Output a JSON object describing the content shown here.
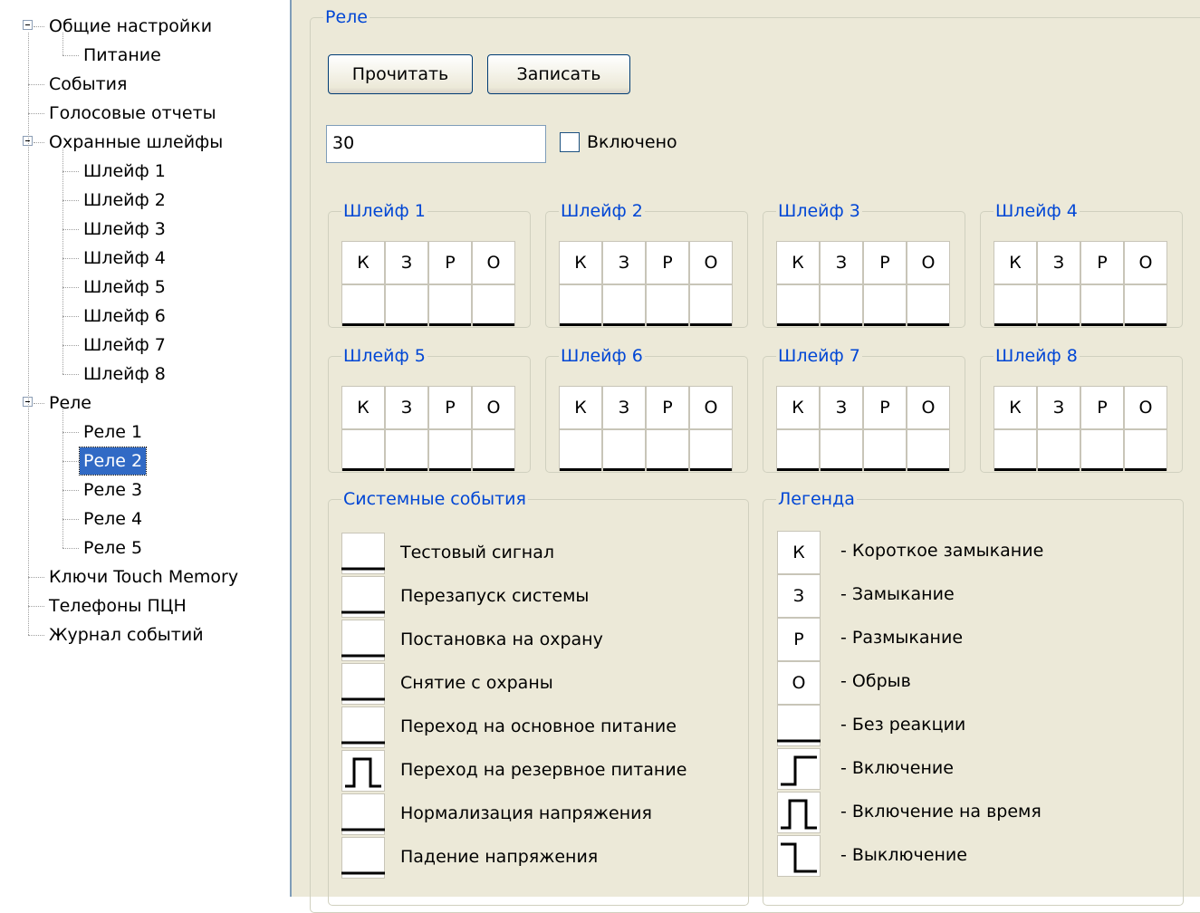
{
  "tree": {
    "items": [
      {
        "label": "Общие настройки",
        "level": 0,
        "expanded": true
      },
      {
        "label": "Питание",
        "level": 1
      },
      {
        "label": "События",
        "level": 0
      },
      {
        "label": "Голосовые отчеты",
        "level": 0
      },
      {
        "label": "Охранные шлейфы",
        "level": 0,
        "expanded": true
      },
      {
        "label": "Шлейф 1",
        "level": 1
      },
      {
        "label": "Шлейф 2",
        "level": 1
      },
      {
        "label": "Шлейф 3",
        "level": 1
      },
      {
        "label": "Шлейф 4",
        "level": 1
      },
      {
        "label": "Шлейф 5",
        "level": 1
      },
      {
        "label": "Шлейф 6",
        "level": 1
      },
      {
        "label": "Шлейф 7",
        "level": 1
      },
      {
        "label": "Шлейф 8",
        "level": 1
      },
      {
        "label": "Реле",
        "level": 0,
        "expanded": true
      },
      {
        "label": "Реле 1",
        "level": 1
      },
      {
        "label": "Реле 2",
        "level": 1,
        "selected": true
      },
      {
        "label": "Реле 3",
        "level": 1
      },
      {
        "label": "Реле 4",
        "level": 1
      },
      {
        "label": "Реле 5",
        "level": 1
      },
      {
        "label": "Ключи Touch Memory",
        "level": 0
      },
      {
        "label": "Телефоны ПЦН",
        "level": 0
      },
      {
        "label": "Журнал событий",
        "level": 0
      }
    ]
  },
  "relay": {
    "group_title": "Реле",
    "read_button": "Прочитать",
    "write_button": "Записать",
    "value": "30",
    "enabled_label": "Включено",
    "enabled_checked": false
  },
  "loops": [
    {
      "title": "Шлейф 1",
      "cols": [
        "К",
        "З",
        "Р",
        "О"
      ]
    },
    {
      "title": "Шлейф 2",
      "cols": [
        "К",
        "З",
        "Р",
        "О"
      ]
    },
    {
      "title": "Шлейф 3",
      "cols": [
        "К",
        "З",
        "Р",
        "О"
      ]
    },
    {
      "title": "Шлейф 4",
      "cols": [
        "К",
        "З",
        "Р",
        "О"
      ]
    },
    {
      "title": "Шлейф 5",
      "cols": [
        "К",
        "З",
        "Р",
        "О"
      ]
    },
    {
      "title": "Шлейф 6",
      "cols": [
        "К",
        "З",
        "Р",
        "О"
      ]
    },
    {
      "title": "Шлейф 7",
      "cols": [
        "К",
        "З",
        "Р",
        "О"
      ]
    },
    {
      "title": "Шлейф 8",
      "cols": [
        "К",
        "З",
        "Р",
        "О"
      ]
    }
  ],
  "system_events": {
    "title": "Системные события",
    "items": [
      {
        "label": "Тестовый сигнал",
        "signal": "low"
      },
      {
        "label": "Перезапуск системы",
        "signal": "low"
      },
      {
        "label": "Постановка на охрану",
        "signal": "low"
      },
      {
        "label": "Снятие с  охраны",
        "signal": "low"
      },
      {
        "label": "Переход на основное питание",
        "signal": "low"
      },
      {
        "label": "Переход на резервное питание",
        "signal": "pulse"
      },
      {
        "label": "Нормализация напряжения",
        "signal": "low"
      },
      {
        "label": "Падение напряжения",
        "signal": "low"
      }
    ]
  },
  "legend": {
    "title": "Легенда",
    "items": [
      {
        "symbol": "К",
        "text": "- Короткое замыкание"
      },
      {
        "symbol": "З",
        "text": "- Замыкание"
      },
      {
        "symbol": "Р",
        "text": "- Размыкание"
      },
      {
        "symbol": "О",
        "text": "- Обрыв"
      },
      {
        "symbol": "",
        "signal": "low",
        "text": "- Без реакции"
      },
      {
        "symbol": "",
        "signal": "on",
        "text": "- Включение"
      },
      {
        "symbol": "",
        "signal": "pulse",
        "text": "- Включение на время"
      },
      {
        "symbol": "",
        "signal": "off",
        "text": "- Выключение"
      }
    ]
  }
}
